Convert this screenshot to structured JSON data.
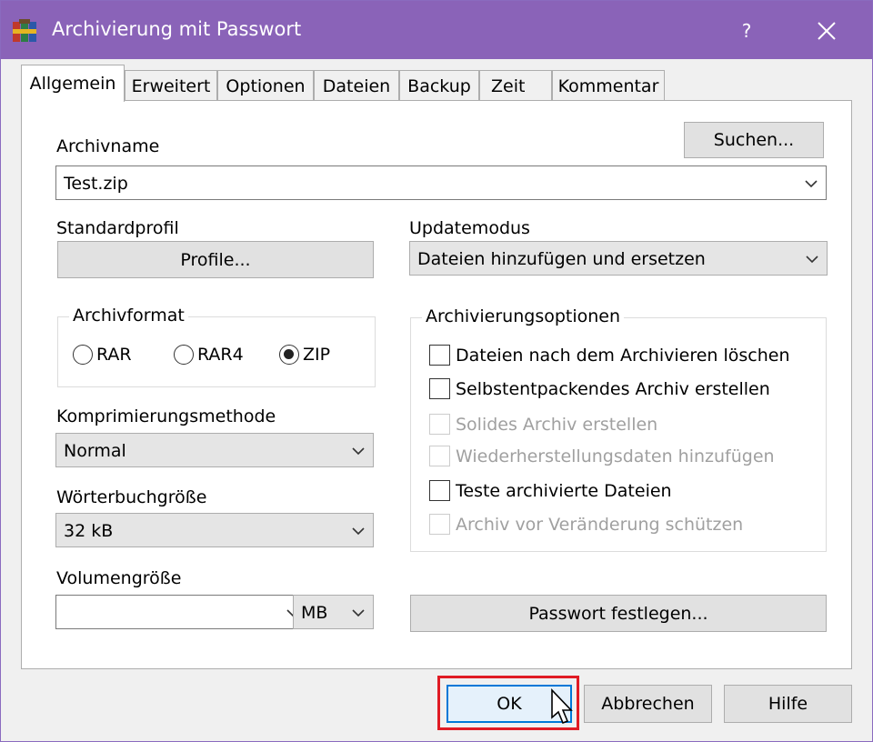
{
  "window": {
    "title": "Archivierung mit Passwort",
    "help_label": "?"
  },
  "tabs": [
    {
      "label": "Allgemein",
      "active": true
    },
    {
      "label": "Erweitert"
    },
    {
      "label": "Optionen"
    },
    {
      "label": "Dateien"
    },
    {
      "label": "Backup"
    },
    {
      "label": "Zeit"
    },
    {
      "label": "Kommentar"
    }
  ],
  "general": {
    "archive_name_label": "Archivname",
    "search_button": "Suchen...",
    "archive_name_value": "Test.zip",
    "standard_profile_label": "Standardprofil",
    "profiles_button": "Profile...",
    "update_mode_label": "Updatemodus",
    "update_mode_value": "Dateien hinzufügen und ersetzen",
    "archive_format": {
      "title": "Archivformat",
      "options": [
        "RAR",
        "RAR4",
        "ZIP"
      ],
      "selected": "ZIP"
    },
    "compression_label": "Komprimierungsmethode",
    "compression_value": "Normal",
    "dictionary_label": "Wörterbuchgröße",
    "dictionary_value": "32 kB",
    "volume_label": "Volumengröße",
    "volume_value": "",
    "volume_unit": "MB",
    "archiving_options": {
      "title": "Archivierungsoptionen",
      "items": [
        {
          "label": "Dateien nach dem Archivieren löschen",
          "checked": false,
          "enabled": true
        },
        {
          "label": "Selbstentpackendes Archiv erstellen",
          "checked": false,
          "enabled": true
        },
        {
          "label": "Solides Archiv erstellen",
          "checked": false,
          "enabled": false
        },
        {
          "label": "Wiederherstellungsdaten hinzufügen",
          "checked": false,
          "enabled": false
        },
        {
          "label": "Teste archivierte Dateien",
          "checked": false,
          "enabled": true
        },
        {
          "label": "Archiv vor Veränderung schützen",
          "checked": false,
          "enabled": false
        }
      ]
    },
    "set_password_button": "Passwort festlegen..."
  },
  "footer": {
    "ok": "OK",
    "cancel": "Abbrechen",
    "help": "Hilfe"
  },
  "colors": {
    "titlebar": "#8a63b8",
    "highlight": "#e01b24"
  }
}
